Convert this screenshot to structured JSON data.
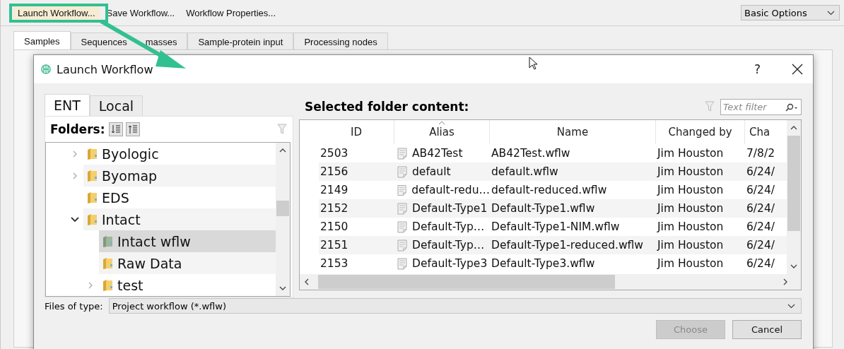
{
  "toolbar": {
    "buttons": [
      "Launch Workflow...",
      "Save Workflow...",
      "Workflow Properties..."
    ],
    "mode_select": {
      "value": "Basic Options"
    }
  },
  "tabs": [
    {
      "label": "Samples",
      "selected": true
    },
    {
      "label_parts": [
        "Sequences",
        "masses"
      ],
      "selected": false
    },
    {
      "label": "Sample-protein input",
      "selected": false
    },
    {
      "label": "Processing nodes",
      "selected": false
    }
  ],
  "dialog": {
    "title": "Launch Workflow",
    "help": "?",
    "source_tabs": [
      {
        "label": "ENT",
        "selected": true
      },
      {
        "label": "Local",
        "selected": false
      }
    ],
    "folders_label": "Folders:",
    "tree": [
      {
        "label": "Byologic",
        "kind": "folder",
        "expanded": false,
        "selected": false
      },
      {
        "label": "Byomap",
        "kind": "folder",
        "expanded": false,
        "selected": false
      },
      {
        "label": "EDS",
        "kind": "folder",
        "selected": false
      },
      {
        "label": "Intact",
        "kind": "folder",
        "expanded": true,
        "selected": false,
        "children": [
          {
            "label": "Intact wflw",
            "kind": "workflow-folder",
            "selected": true
          },
          {
            "label": "Raw Data",
            "kind": "folder",
            "selected": false
          },
          {
            "label": "test",
            "kind": "folder",
            "expanded": false,
            "selected": false
          }
        ]
      }
    ],
    "content_title": "Selected folder content:",
    "filter": {
      "placeholder": "Text filter"
    },
    "table": {
      "columns": [
        {
          "label": "ID",
          "sorted": false
        },
        {
          "label": "Alias",
          "sorted": true
        },
        {
          "label": "Name",
          "sorted": false
        },
        {
          "label": "Changed by",
          "sorted": false
        },
        {
          "label": "Cha",
          "sorted": false
        }
      ],
      "rows": [
        [
          "2503",
          "AB42Test",
          "AB42Test.wflw",
          "Jim Houston",
          "7/8/2"
        ],
        [
          "2156",
          "default",
          "default.wflw",
          "Jim Houston",
          "6/24/"
        ],
        [
          "2149",
          "default-redu…",
          "default-reduced.wflw",
          "Jim Houston",
          "6/24/"
        ],
        [
          "2152",
          "Default-Type1",
          "Default-Type1.wflw",
          "Jim Houston",
          "6/24/"
        ],
        [
          "2150",
          "Default-Typ…",
          "Default-Type1-NIM.wflw",
          "Jim Houston",
          "6/24/"
        ],
        [
          "2151",
          "Default-Typ…",
          "Default-Type1-reduced.wflw",
          "Jim Houston",
          "6/24/"
        ],
        [
          "2153",
          "Default-Type3",
          "Default-Type3.wflw",
          "Jim Houston",
          "6/24/"
        ]
      ]
    },
    "files_of_type": {
      "label": "Files of type:",
      "value": "Project workflow (*.wflw)"
    },
    "buttons": [
      {
        "label": "Choose",
        "disabled": true
      },
      {
        "label": "Cancel",
        "disabled": false
      }
    ]
  }
}
